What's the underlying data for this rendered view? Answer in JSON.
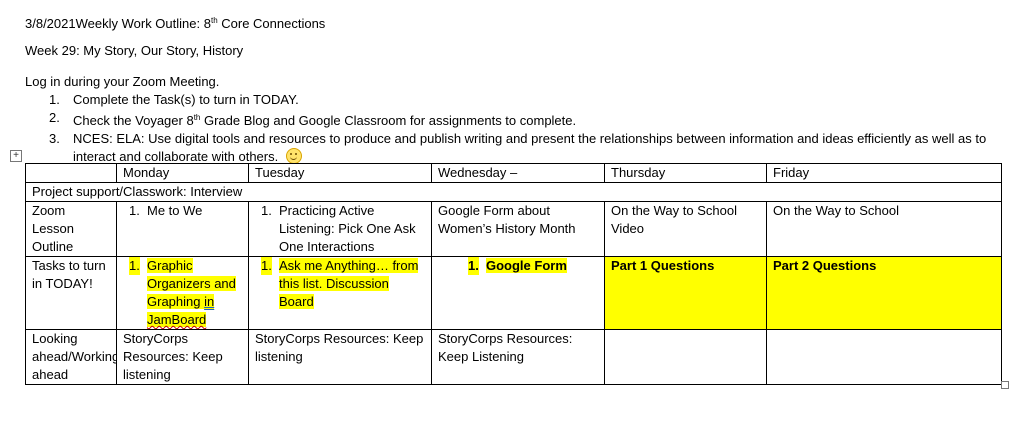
{
  "header": {
    "date": "3/8/2021",
    "title_prefix": "Weekly Work Outline: 8",
    "title_sup": "th",
    "title_suffix": " Core Connections",
    "week": "Week 29: My Story, Our Story, History"
  },
  "intro": "Log in during your Zoom Meeting.",
  "tasks": [
    {
      "num": "1.",
      "text": "Complete the Task(s) to turn in TODAY."
    },
    {
      "num": "2.",
      "pre": "Check the Voyager 8",
      "sup": "th",
      "post": " Grade Blog and Google Classroom for assignments to complete."
    },
    {
      "num": "3.",
      "text": "NCES: ELA: Use digital tools and resources to produce and publish writing and present the relationships between information and ideas efficiently as well as to interact and collaborate with others."
    }
  ],
  "smiley_icon": "smiling-face-emoji",
  "table": {
    "days": [
      "Monday",
      "Tuesday",
      "Wednesday –",
      "Thursday",
      "Friday"
    ],
    "project_row": "Project support/Classwork: Interview",
    "zoom": {
      "label": "Zoom Lesson Outline",
      "monday": {
        "num": "1.",
        "text": "Me to We"
      },
      "tuesday": {
        "num": "1.",
        "text": "Practicing Active Listening: Pick One Ask One Interactions"
      },
      "wednesday": "Google Form about Women’s History Month",
      "thursday": "On the Way to School Video",
      "friday": "On the Way to School"
    },
    "tasks_row": {
      "label": "Tasks to turn in TODAY!",
      "monday": {
        "num": "1.",
        "text_a": "Graphic Organizers and Graphing ",
        "text_b": "in",
        "text_c": "JamBoard"
      },
      "tuesday": {
        "num": "1.",
        "text": "Ask me Anything… from this list. Discussion Board"
      },
      "wednesday": {
        "num": "1.",
        "text": "Google Form"
      },
      "thursday": "Part 1 Questions",
      "friday": "Part 2 Questions"
    },
    "looking": {
      "label": "Looking ahead/Working ahead",
      "monday": "StoryCorps Resources:  Keep listening",
      "tuesday": "StoryCorps Resources: Keep listening",
      "wednesday": "StoryCorps Resources: Keep Listening",
      "thursday": "",
      "friday": ""
    }
  },
  "colors": {
    "highlight": "#ffff00",
    "text": "#000000"
  }
}
